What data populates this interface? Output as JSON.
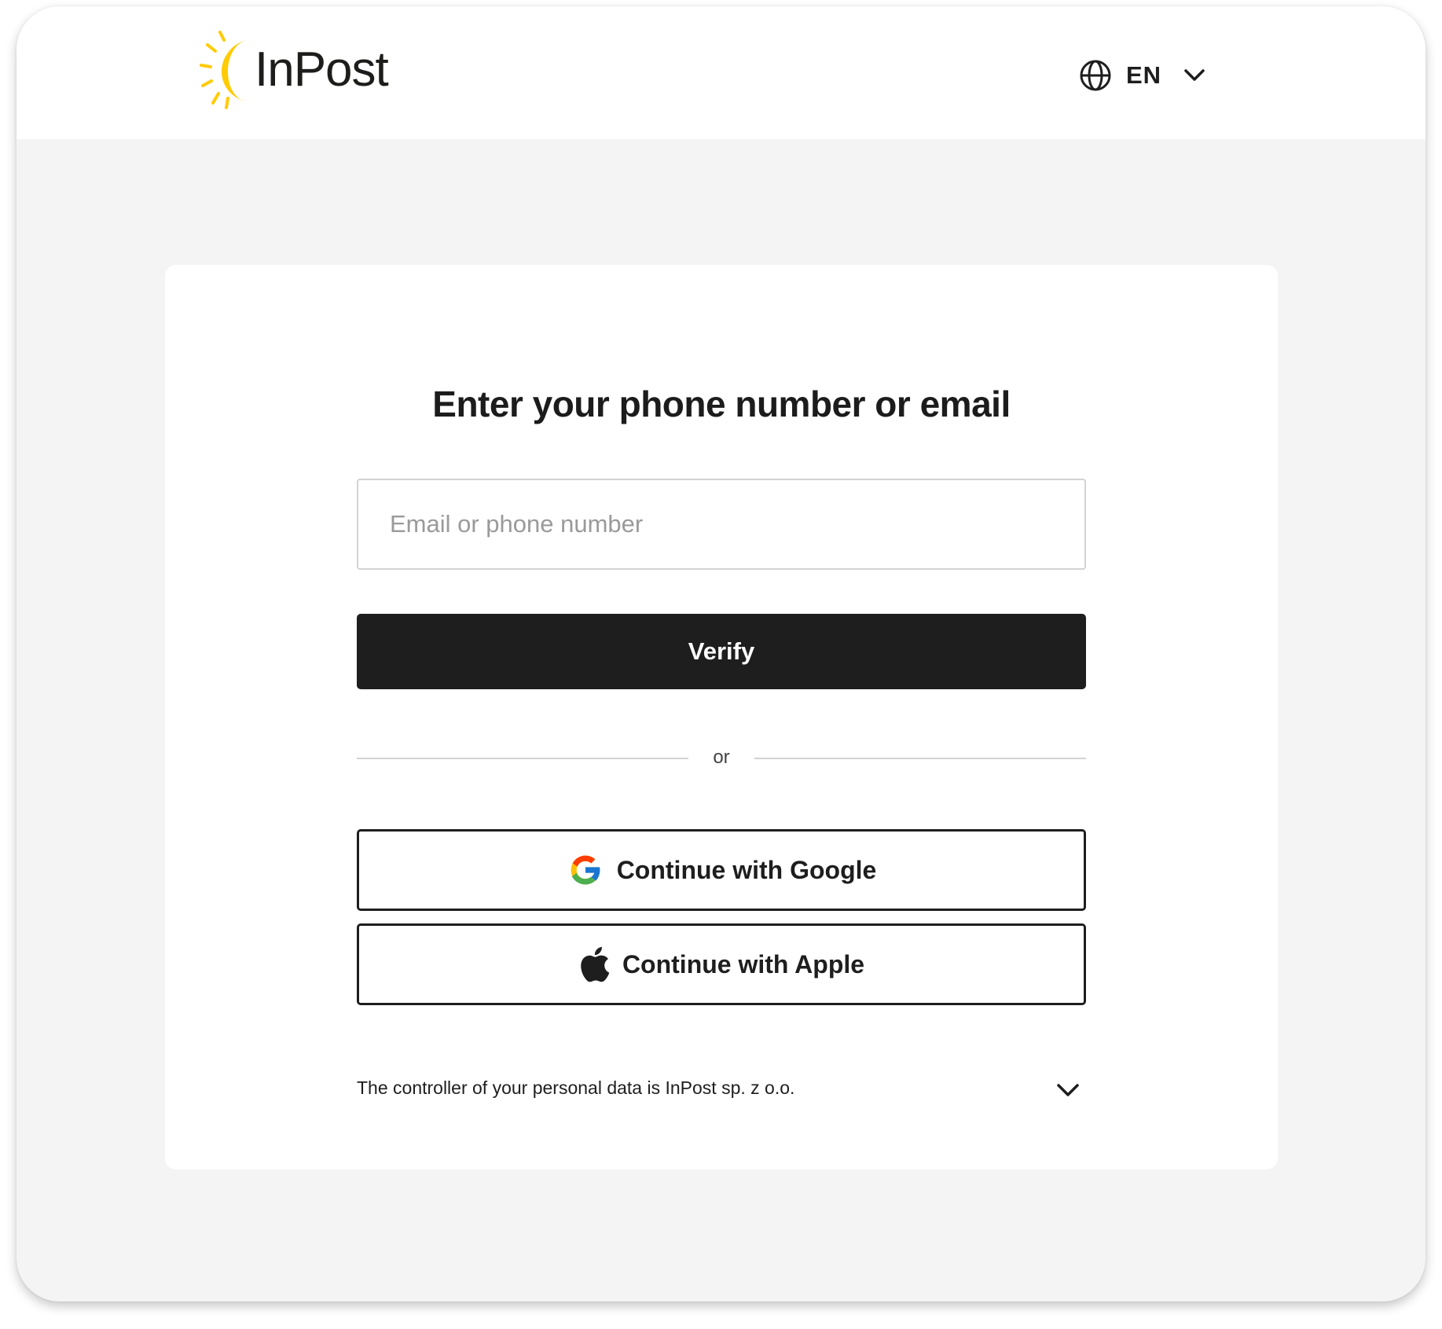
{
  "header": {
    "logo_text": "InPost",
    "language": {
      "label": "EN"
    }
  },
  "login": {
    "title": "Enter your phone number or email",
    "input_placeholder": "Email or phone number",
    "input_value": "",
    "verify_label": "Verify",
    "divider_text": "or",
    "google_label": "Continue with Google",
    "apple_label": "Continue with Apple"
  },
  "legal": {
    "text": "The controller of your personal data is InPost sp. z o.o."
  },
  "colors": {
    "brand_yellow": "#FFCB04",
    "dark": "#1E1E1E",
    "page_bg": "#F4F4F4"
  },
  "icons": {
    "logo": "inpost-sun-logo-icon",
    "language": "globe-icon",
    "language_dropdown": "chevron-down-icon",
    "google": "google-g-icon",
    "apple": "apple-icon",
    "legal_expand": "chevron-down-icon"
  }
}
